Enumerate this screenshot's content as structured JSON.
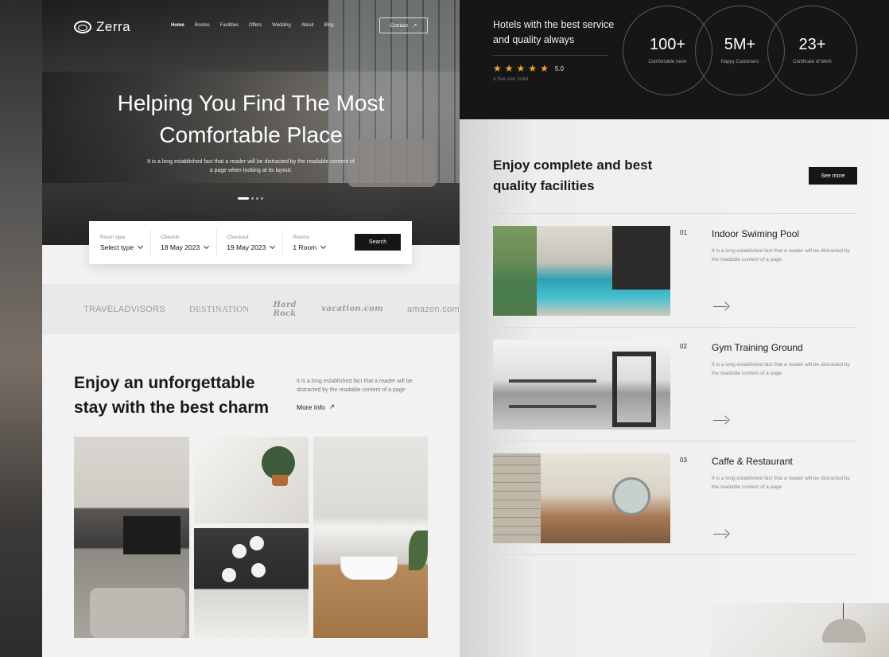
{
  "brand": {
    "name": "Zerra"
  },
  "nav": {
    "items": [
      "Home",
      "Rooms",
      "Facilities",
      "Offers",
      "Wedding",
      "About",
      "Blog"
    ],
    "active": "Home",
    "contact_label": "Contact"
  },
  "hero": {
    "title_line1": "Helping You Find The Most",
    "title_line2": "Comfortable Place",
    "subtitle": "It is a long established fact that a reader will be distracted by the readable content of a page when looking at its layout."
  },
  "booking": {
    "room_type": {
      "label": "Room type",
      "value": "Select type"
    },
    "checkin": {
      "label": "Checkin",
      "value": "18 May 2023"
    },
    "checkout": {
      "label": "Checkout",
      "value": "19 May 2023"
    },
    "rooms": {
      "label": "Rooms",
      "value": "1 Room"
    },
    "search_label": "Search"
  },
  "partners": [
    "TRAVELADVISORS",
    "DESTINATION",
    "Hard Rock",
    "vacation.com",
    "amazon.com"
  ],
  "stay": {
    "title": "Enjoy an unforgettable stay with the best charm",
    "description": "It is a long established fact that a reader will be distracted by the readable content of a page",
    "more_info_label": "More Info"
  },
  "stats_header": {
    "tagline": "Hotels with the best service and quality always",
    "rating": "5.0",
    "rating_stars": 5,
    "rating_caption": "a five-star hotel"
  },
  "stats": [
    {
      "number": "100+",
      "label": "Comfortable room"
    },
    {
      "number": "5M+",
      "label": "Happy Customers"
    },
    {
      "number": "23+",
      "label": "Certificate of Merit"
    }
  ],
  "facilities": {
    "title": "Enjoy complete and best quality facilities",
    "see_more_label": "See more",
    "items": [
      {
        "number": "01",
        "name": "Indoor Swiming Pool",
        "description": "It is a long established fact that a reader will be distracted by the readable content of a page"
      },
      {
        "number": "02",
        "name": "Gym Training Ground",
        "description": "It is a long established fact that a reader will be distracted by the readable content of a page"
      },
      {
        "number": "03",
        "name": "Caffe & Restaurant",
        "description": "It is a long established fact that a reader will be distracted by the readable content of a page"
      }
    ]
  },
  "colors": {
    "dark": "#161616",
    "star": "#f0a932",
    "light_bg": "#f2f2f2"
  }
}
